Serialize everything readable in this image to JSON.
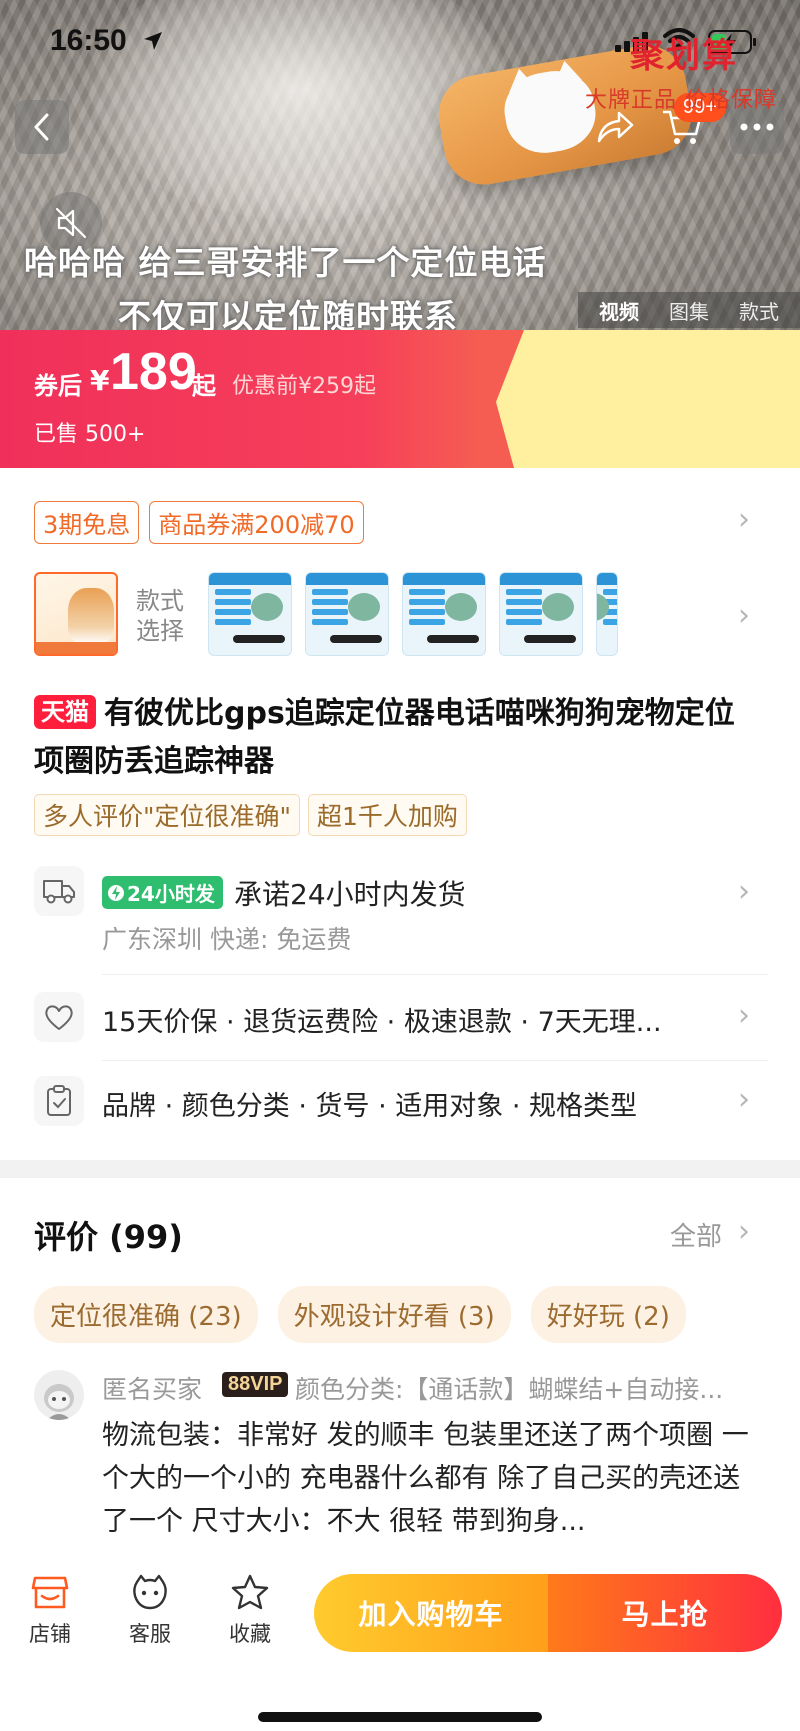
{
  "status_bar": {
    "time": "16:50"
  },
  "header": {
    "cart_badge": "99+"
  },
  "media": {
    "subtitle_line1": "哈哈哈 给三哥安排了一个定位电话",
    "subtitle_line2": "不仅可以定位随时联系",
    "tabs": [
      "视频",
      "图集",
      "款式"
    ],
    "active_tab": "视频"
  },
  "price": {
    "after_coupon_label": "券后",
    "currency": "¥",
    "value": "189",
    "from_suffix": "起",
    "original": "优惠前¥259起",
    "sold": "已售 500+",
    "juhuasuan_title": "聚划算",
    "juhuasuan_sub": "大牌正品 价格保障"
  },
  "promos": [
    "3期免息",
    "商品券满200减70"
  ],
  "variants": {
    "label": "款式选择",
    "count": 6
  },
  "product": {
    "badge": "天猫",
    "title": "有彼优比gps追踪定位器电话喵咪狗狗宠物定位项圈防丢追踪神器",
    "tags": [
      "多人评价\"定位很准确\"",
      "超1千人加购"
    ]
  },
  "shipping": {
    "badge": "24小时发",
    "promise": "承诺24小时内发货",
    "origin": "广东深圳  快递: 免运费"
  },
  "service": {
    "text": "15天价保 · 退货运费险 · 极速退款 · 7天无理..."
  },
  "params": {
    "text": "品牌 · 颜色分类 · 货号 · 适用对象 · 规格类型"
  },
  "reviews": {
    "title": "评价 (99)",
    "all_label": "全部",
    "tags": [
      "定位很准确 (23)",
      "外观设计好看 (3)",
      "好好玩 (2)"
    ],
    "first": {
      "user": "匿名买家",
      "vip": "88VIP",
      "spec": "颜色分类:【通话款】蝴蝶结+自动接...",
      "body": "物流包装：非常好 发的顺丰 包装里还送了两个项圈 一个大的一个小的 充电器什么都有 除了自己买的壳还送了一个 尺寸大小：不大 很轻 带到狗身..."
    }
  },
  "bottom_bar": {
    "shop": "店铺",
    "service": "客服",
    "favorite": "收藏",
    "add_to_cart": "加入购物车",
    "buy_now": "马上抢"
  },
  "colors": {
    "accent": "#ff4f1c",
    "price_red": "#f0305a",
    "juhuasuan_bg": "#fff0a0",
    "cart_yellow": "#ffb21e",
    "buy_red": "#ff2e3f"
  }
}
